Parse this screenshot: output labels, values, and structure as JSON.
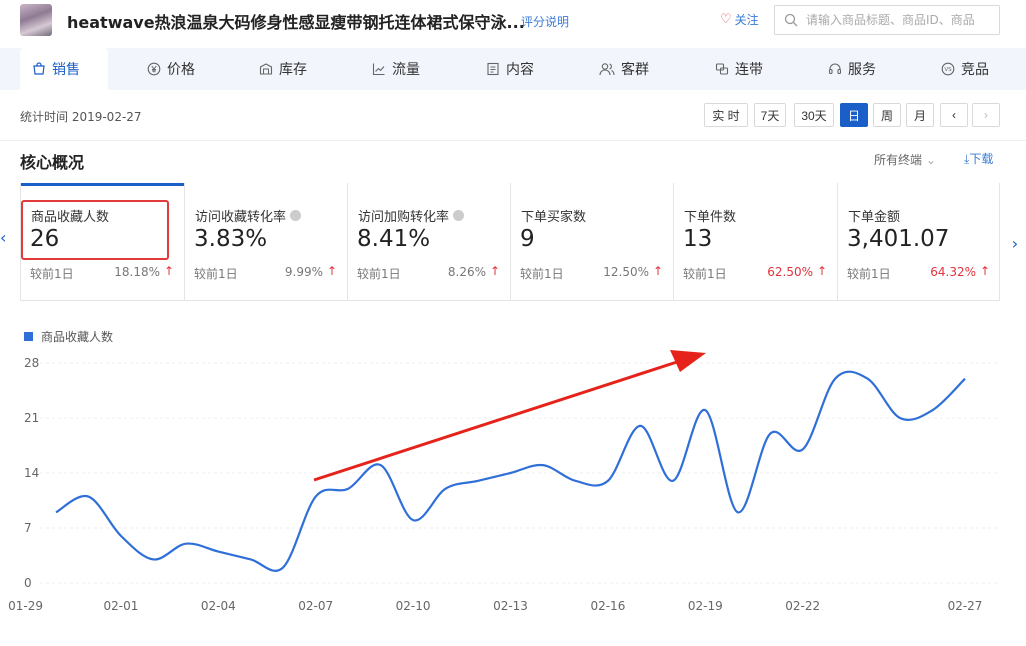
{
  "header": {
    "product_title": "heatwave热浪温泉大码修身性感显瘦带钢托连体裙式保守泳...",
    "score_link": "评分说明",
    "follow_label": "关注",
    "search_placeholder": "请输入商品标题、商品ID、商品"
  },
  "tabs": [
    {
      "label": "销售",
      "icon": "cart-icon"
    },
    {
      "label": "价格",
      "icon": "yen-icon"
    },
    {
      "label": "库存",
      "icon": "warehouse-icon"
    },
    {
      "label": "流量",
      "icon": "trend-icon"
    },
    {
      "label": "内容",
      "icon": "doc-icon"
    },
    {
      "label": "客群",
      "icon": "users-icon"
    },
    {
      "label": "连带",
      "icon": "link-icon"
    },
    {
      "label": "服务",
      "icon": "headset-icon"
    },
    {
      "label": "竞品",
      "icon": "vs-icon"
    }
  ],
  "stat": {
    "time_label": "统计时间 2019-02-27",
    "periods": [
      "实 时",
      "7天",
      "30天",
      "日",
      "周",
      "月"
    ],
    "active_period": "日"
  },
  "section": {
    "title": "核心概况",
    "terminal_label": "所有终端",
    "download_label": "下载"
  },
  "cards": [
    {
      "label": "商品收藏人数",
      "value": "26",
      "cmp": "较前1日",
      "pct": "18.18%",
      "pct_color": "#777777",
      "info": false
    },
    {
      "label": "访问收藏转化率",
      "value": "3.83%",
      "cmp": "较前1日",
      "pct": "9.99%",
      "pct_color": "#777777",
      "info": true
    },
    {
      "label": "访问加购转化率",
      "value": "8.41%",
      "cmp": "较前1日",
      "pct": "8.26%",
      "pct_color": "#777777",
      "info": true
    },
    {
      "label": "下单买家数",
      "value": "9",
      "cmp": "较前1日",
      "pct": "12.50%",
      "pct_color": "#777777",
      "info": false
    },
    {
      "label": "下单件数",
      "value": "13",
      "cmp": "较前1日",
      "pct": "62.50%",
      "pct_color": "#e0333e",
      "info": false
    },
    {
      "label": "下单金额",
      "value": "3,401.07",
      "cmp": "较前1日",
      "pct": "64.32%",
      "pct_color": "#e0333e",
      "info": false
    }
  ],
  "colors": {
    "accent": "#1a5ec7",
    "up_red": "#e0333e",
    "line": "#2f6fd8"
  },
  "chart_data": {
    "type": "line",
    "legend": "商品收藏人数",
    "series": [
      {
        "name": "商品收藏人数",
        "values": [
          9,
          11,
          6,
          3,
          5,
          4,
          3,
          2,
          11,
          12,
          15,
          8,
          12,
          13,
          14,
          15,
          13,
          13,
          20,
          13,
          22,
          9,
          19,
          17,
          26,
          26,
          21,
          22,
          26
        ]
      }
    ],
    "x": [
      "01-30",
      "01-31",
      "02-01",
      "02-02",
      "02-03",
      "02-04",
      "02-05",
      "02-06",
      "02-07",
      "02-08",
      "02-09",
      "02-10",
      "02-11",
      "02-12",
      "02-13",
      "02-14",
      "02-15",
      "02-16",
      "02-17",
      "02-18",
      "02-19",
      "02-20",
      "02-21",
      "02-22",
      "02-23",
      "02-24",
      "02-25",
      "02-26",
      "02-27"
    ],
    "xticks": [
      "01-29",
      "02-01",
      "02-04",
      "02-07",
      "02-10",
      "02-13",
      "02-16",
      "02-19",
      "02-22",
      "02-27"
    ],
    "yticks": [
      0,
      7,
      14,
      21,
      28
    ],
    "ylim": [
      0,
      28
    ]
  }
}
